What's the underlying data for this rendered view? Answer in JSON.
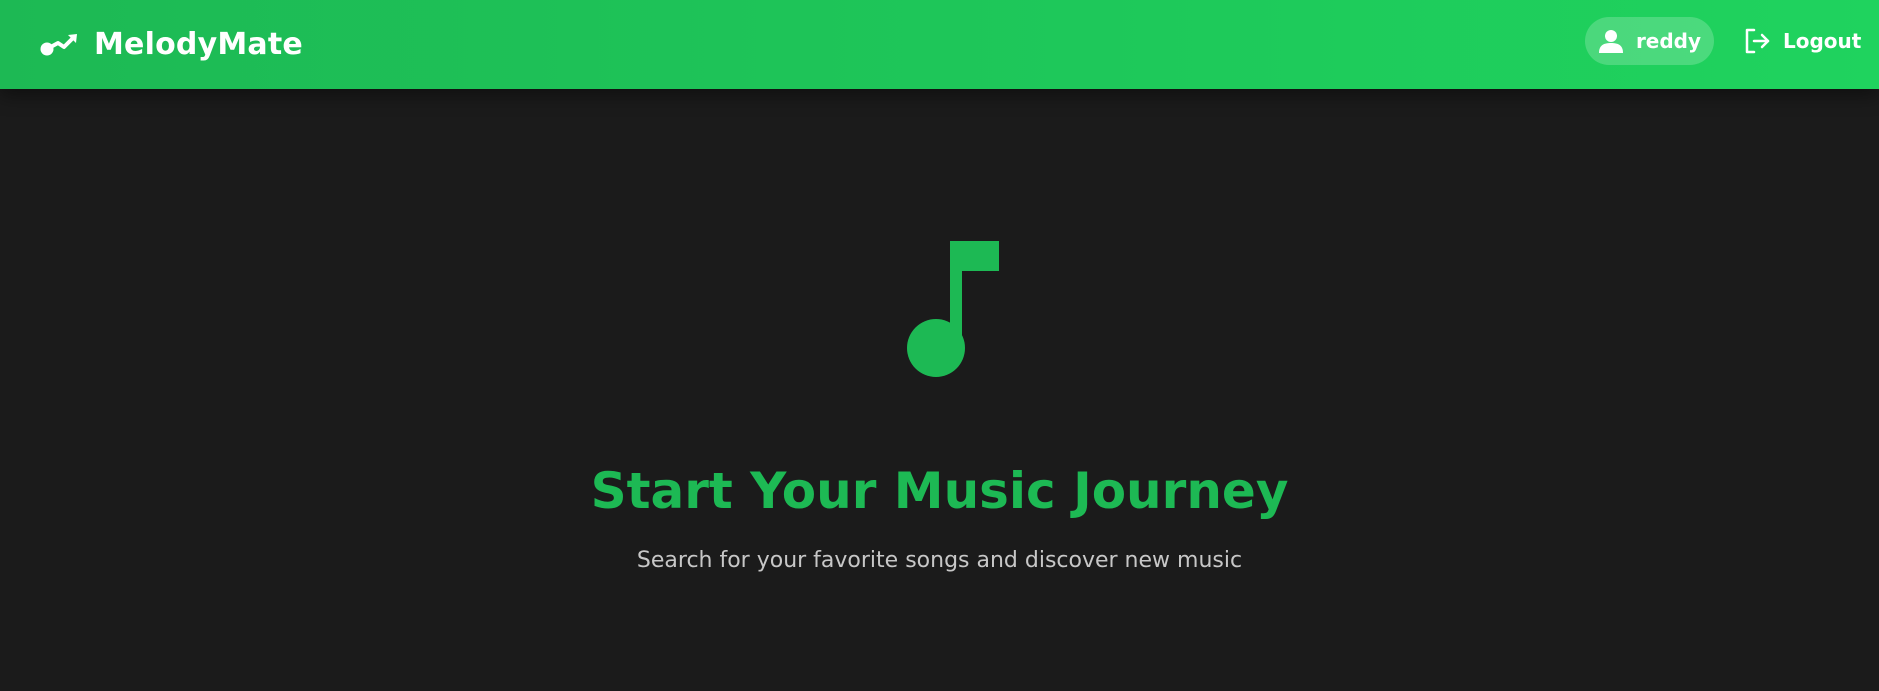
{
  "navbar": {
    "brand_name": "MelodyMate",
    "brand_icon": "chart-line-icon",
    "user": {
      "icon": "user-icon",
      "name": "reddy"
    },
    "logout": {
      "icon": "logout-icon",
      "label": "Logout"
    }
  },
  "hero": {
    "icon": "music-note-icon",
    "title": "Start Your Music Journey",
    "subtitle": "Search for your favorite songs and discover new music"
  },
  "colors": {
    "accent": "#1db954",
    "navbar_gradient_end": "#1fd35e",
    "background": "#1b1b1b",
    "subtitle_text": "#c7c7c7",
    "text_on_accent": "#ffffff"
  }
}
